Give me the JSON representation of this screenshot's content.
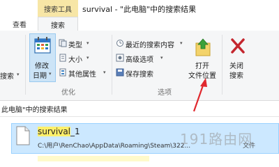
{
  "titlebar": {
    "context_group": "搜索工具",
    "title": "survival - \"此电脑\"中的搜索结果"
  },
  "tabs": [
    {
      "label": "查看"
    },
    {
      "label": "搜索"
    }
  ],
  "ribbon": {
    "left_cut_label": "搜索",
    "optimize": {
      "modify_date": {
        "line1": "修改",
        "line2": "日期"
      },
      "type": "类型",
      "size": "大小",
      "other_props": "其他属性",
      "group_label": "优化"
    },
    "options": {
      "recent_searches": "最近的搜索内容",
      "advanced_options": "高级选项",
      "save_search": "保存搜索",
      "open_location": {
        "line1": "打开",
        "line2": "文件位置"
      },
      "group_label": "选项"
    },
    "close_search": {
      "line1": "关闭",
      "line2": "搜索"
    }
  },
  "path_bar": {
    "text": "此电脑\"中的搜索结果"
  },
  "results": [
    {
      "name_highlight": "survival",
      "name_rest": "_1",
      "path": "C:\\用户\\RenChao\\AppData\\Roaming\\Steam\\322...",
      "type_cut": "文件"
    }
  ],
  "watermark": "191路由网",
  "colors": {
    "accent_selected": "#cce8ff",
    "search_highlight": "#fff06a",
    "context_tab": "#f7e6a6",
    "annotation_arrow": "#e0282e"
  }
}
